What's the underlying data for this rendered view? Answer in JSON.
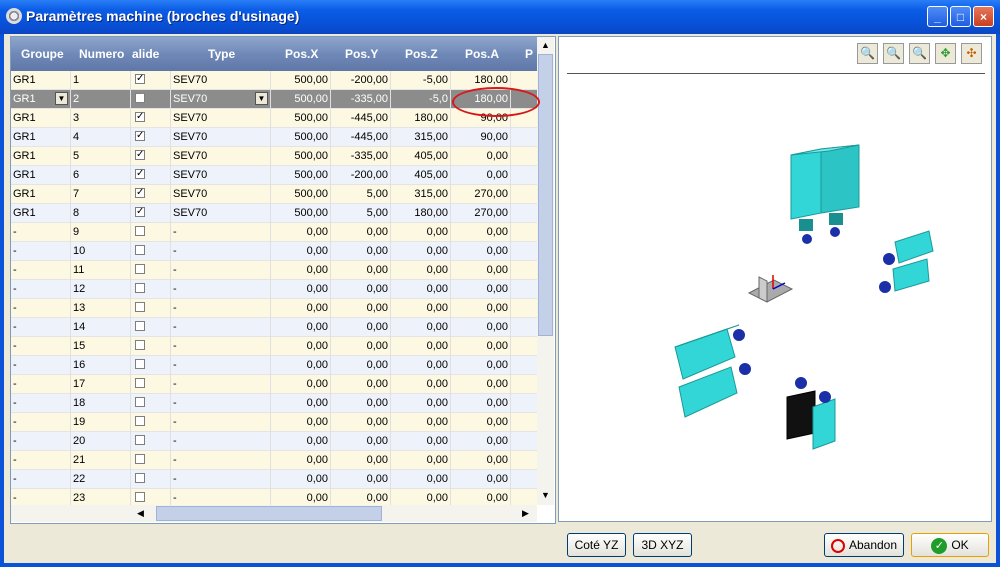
{
  "window": {
    "title": "Paramètres machine (broches d'usinage)",
    "min": "_",
    "max": "□",
    "close": "×"
  },
  "grid": {
    "columns": [
      "Groupe",
      "Numero",
      "alide",
      "Type",
      "Pos.X",
      "Pos.Y",
      "Pos.Z",
      "Pos.A",
      "P"
    ],
    "rows": [
      {
        "groupe": "GR1",
        "numero": "1",
        "valide": true,
        "type": "SEV70",
        "x": "500,00",
        "y": "-200,00",
        "z": "-5,00",
        "a": "180,00"
      },
      {
        "groupe": "GR1",
        "numero": "2",
        "valide": true,
        "type": "SEV70",
        "x": "500,00",
        "y": "-335,00",
        "z": "-5,0",
        "a": "180,00"
      },
      {
        "groupe": "GR1",
        "numero": "3",
        "valide": true,
        "type": "SEV70",
        "x": "500,00",
        "y": "-445,00",
        "z": "180,00",
        "a": "90,00"
      },
      {
        "groupe": "GR1",
        "numero": "4",
        "valide": true,
        "type": "SEV70",
        "x": "500,00",
        "y": "-445,00",
        "z": "315,00",
        "a": "90,00"
      },
      {
        "groupe": "GR1",
        "numero": "5",
        "valide": true,
        "type": "SEV70",
        "x": "500,00",
        "y": "-335,00",
        "z": "405,00",
        "a": "0,00"
      },
      {
        "groupe": "GR1",
        "numero": "6",
        "valide": true,
        "type": "SEV70",
        "x": "500,00",
        "y": "-200,00",
        "z": "405,00",
        "a": "0,00"
      },
      {
        "groupe": "GR1",
        "numero": "7",
        "valide": true,
        "type": "SEV70",
        "x": "500,00",
        "y": "5,00",
        "z": "315,00",
        "a": "270,00"
      },
      {
        "groupe": "GR1",
        "numero": "8",
        "valide": true,
        "type": "SEV70",
        "x": "500,00",
        "y": "5,00",
        "z": "180,00",
        "a": "270,00"
      },
      {
        "groupe": "-",
        "numero": "9",
        "valide": false,
        "type": "-",
        "x": "0,00",
        "y": "0,00",
        "z": "0,00",
        "a": "0,00"
      },
      {
        "groupe": "-",
        "numero": "10",
        "valide": false,
        "type": "-",
        "x": "0,00",
        "y": "0,00",
        "z": "0,00",
        "a": "0,00"
      },
      {
        "groupe": "-",
        "numero": "11",
        "valide": false,
        "type": "-",
        "x": "0,00",
        "y": "0,00",
        "z": "0,00",
        "a": "0,00"
      },
      {
        "groupe": "-",
        "numero": "12",
        "valide": false,
        "type": "-",
        "x": "0,00",
        "y": "0,00",
        "z": "0,00",
        "a": "0,00"
      },
      {
        "groupe": "-",
        "numero": "13",
        "valide": false,
        "type": "-",
        "x": "0,00",
        "y": "0,00",
        "z": "0,00",
        "a": "0,00"
      },
      {
        "groupe": "-",
        "numero": "14",
        "valide": false,
        "type": "-",
        "x": "0,00",
        "y": "0,00",
        "z": "0,00",
        "a": "0,00"
      },
      {
        "groupe": "-",
        "numero": "15",
        "valide": false,
        "type": "-",
        "x": "0,00",
        "y": "0,00",
        "z": "0,00",
        "a": "0,00"
      },
      {
        "groupe": "-",
        "numero": "16",
        "valide": false,
        "type": "-",
        "x": "0,00",
        "y": "0,00",
        "z": "0,00",
        "a": "0,00"
      },
      {
        "groupe": "-",
        "numero": "17",
        "valide": false,
        "type": "-",
        "x": "0,00",
        "y": "0,00",
        "z": "0,00",
        "a": "0,00"
      },
      {
        "groupe": "-",
        "numero": "18",
        "valide": false,
        "type": "-",
        "x": "0,00",
        "y": "0,00",
        "z": "0,00",
        "a": "0,00"
      },
      {
        "groupe": "-",
        "numero": "19",
        "valide": false,
        "type": "-",
        "x": "0,00",
        "y": "0,00",
        "z": "0,00",
        "a": "0,00"
      },
      {
        "groupe": "-",
        "numero": "20",
        "valide": false,
        "type": "-",
        "x": "0,00",
        "y": "0,00",
        "z": "0,00",
        "a": "0,00"
      },
      {
        "groupe": "-",
        "numero": "21",
        "valide": false,
        "type": "-",
        "x": "0,00",
        "y": "0,00",
        "z": "0,00",
        "a": "0,00"
      },
      {
        "groupe": "-",
        "numero": "22",
        "valide": false,
        "type": "-",
        "x": "0,00",
        "y": "0,00",
        "z": "0,00",
        "a": "0,00"
      },
      {
        "groupe": "-",
        "numero": "23",
        "valide": false,
        "type": "-",
        "x": "0,00",
        "y": "0,00",
        "z": "0,00",
        "a": "0,00"
      }
    ],
    "selected_row_index": 1
  },
  "viewer": {
    "toolbar_icons": [
      "zoom-out-icon",
      "zoom-in-icon",
      "zoom-fit-icon",
      "pan-icon",
      "rotate-icon"
    ]
  },
  "buttons": {
    "cote_yz": "Coté YZ",
    "view_3d": "3D XYZ",
    "abandon": "Abandon",
    "ok": "OK"
  },
  "colors": {
    "spindle": "#33d6d6",
    "selected_row": "#8c8c8c",
    "highlight_ellipse": "#d81818"
  }
}
